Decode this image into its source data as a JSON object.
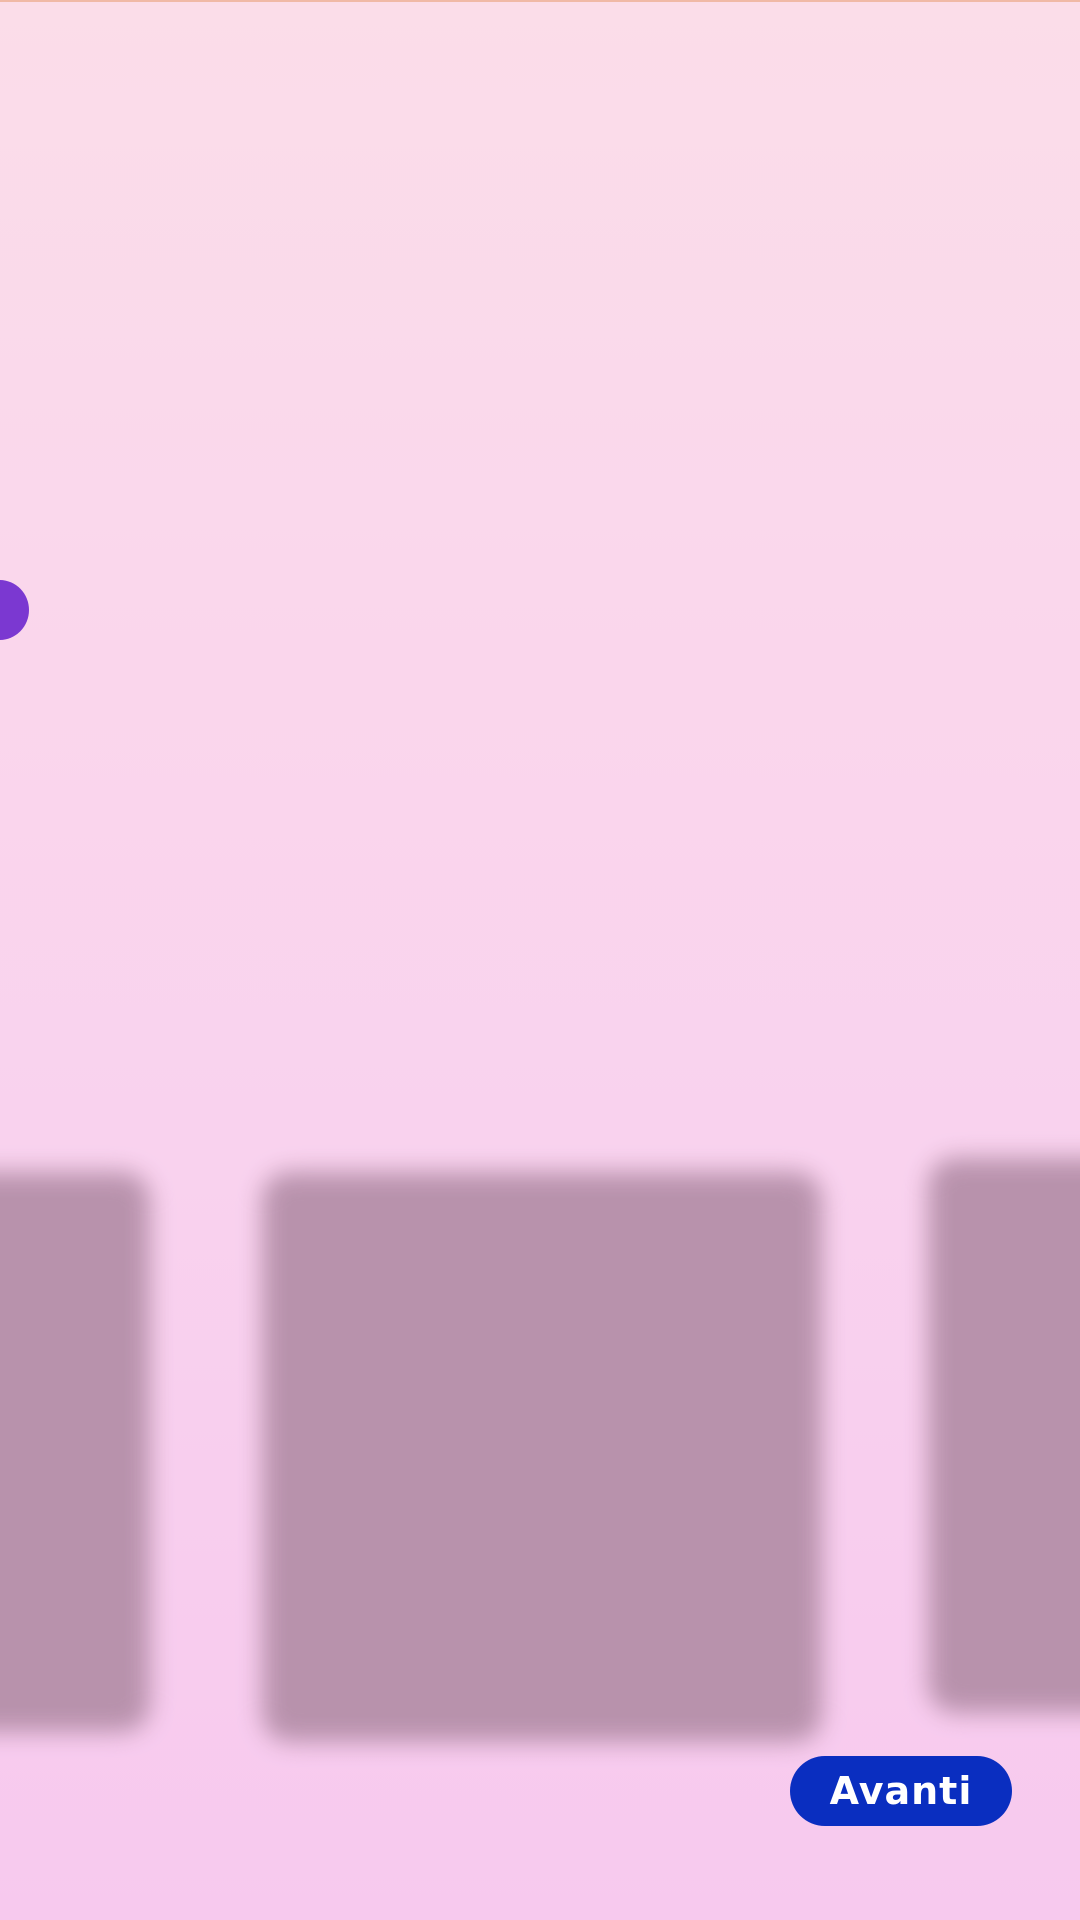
{
  "actions": {
    "next_label": "Avanti"
  },
  "colors": {
    "background_top": "#fbdde9",
    "background_bottom": "#f7c9ee",
    "accent_dot": "#7b38d1",
    "card_placeholder": "#b48ea8",
    "primary_button": "#0a2ec0",
    "primary_button_text": "#ffffff"
  }
}
